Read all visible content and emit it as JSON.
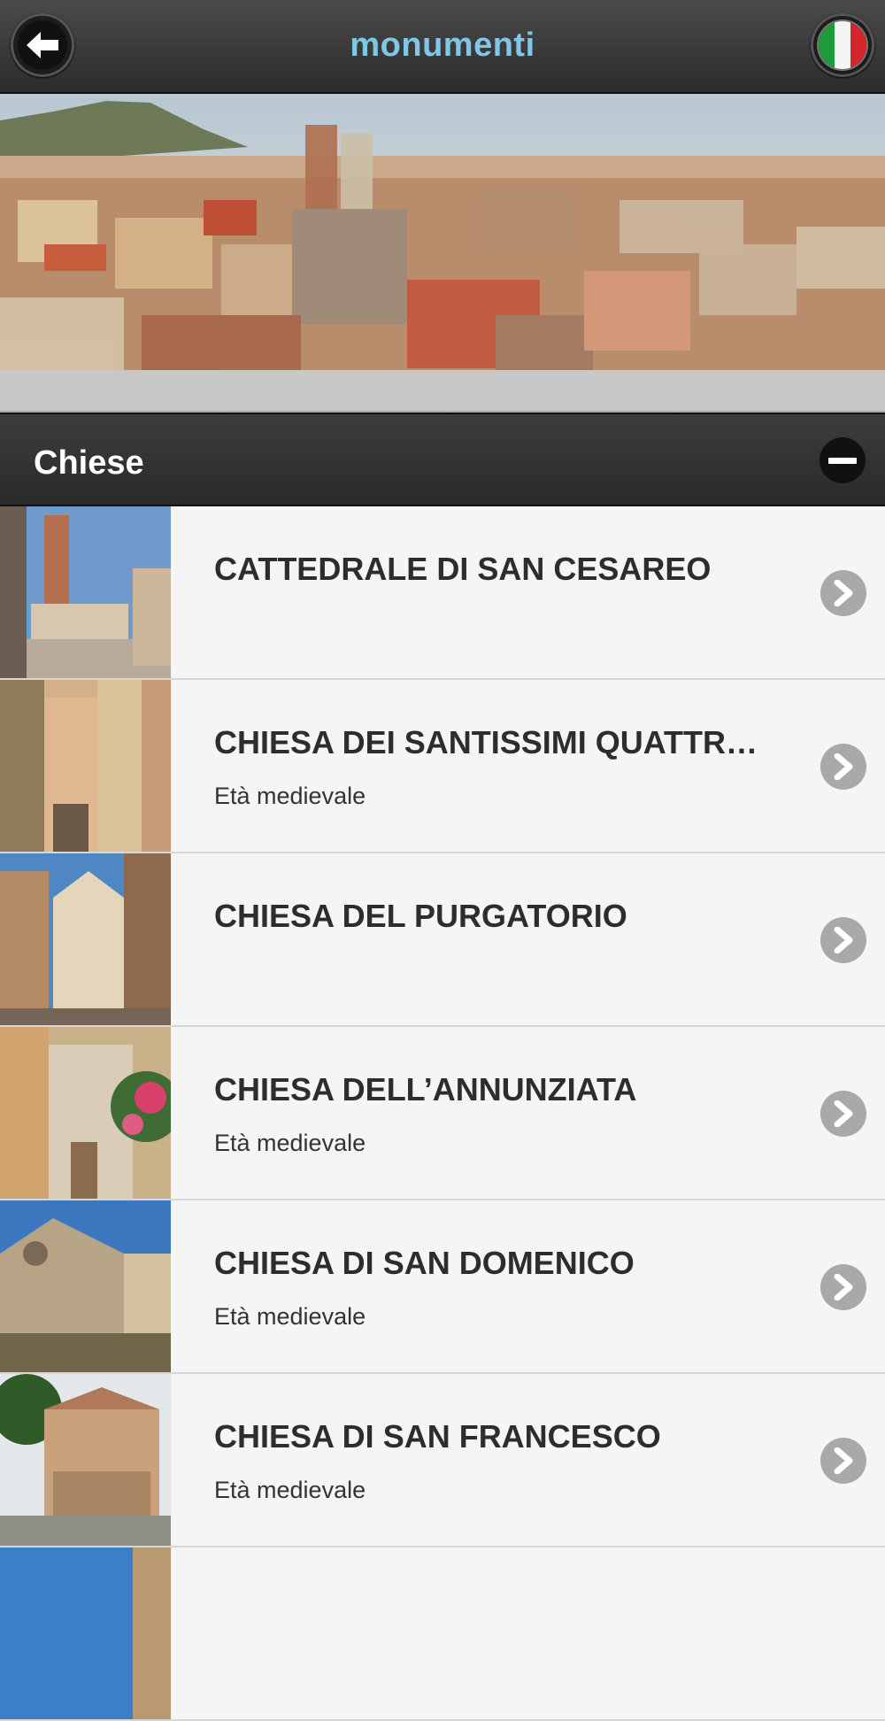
{
  "header": {
    "title": "monumenti",
    "back_icon": "arrow-left-icon",
    "language_icon": "italian-flag-icon",
    "accent_color": "#7ec8e6"
  },
  "section": {
    "label": "Chiese",
    "toggle_icon": "minus-icon"
  },
  "items": [
    {
      "title": "CATTEDRALE DI SAN CESAREO",
      "subtitle": ""
    },
    {
      "title": "CHIESA DEI SANTISSIMI QUATTR…",
      "subtitle": "Età medievale"
    },
    {
      "title": "CHIESA DEL PURGATORIO",
      "subtitle": ""
    },
    {
      "title": "CHIESA DELL’ANNUNZIATA",
      "subtitle": "Età medievale"
    },
    {
      "title": "CHIESA DI SAN DOMENICO",
      "subtitle": "Età medievale"
    },
    {
      "title": "CHIESA DI SAN FRANCESCO",
      "subtitle": "Età medievale"
    }
  ]
}
